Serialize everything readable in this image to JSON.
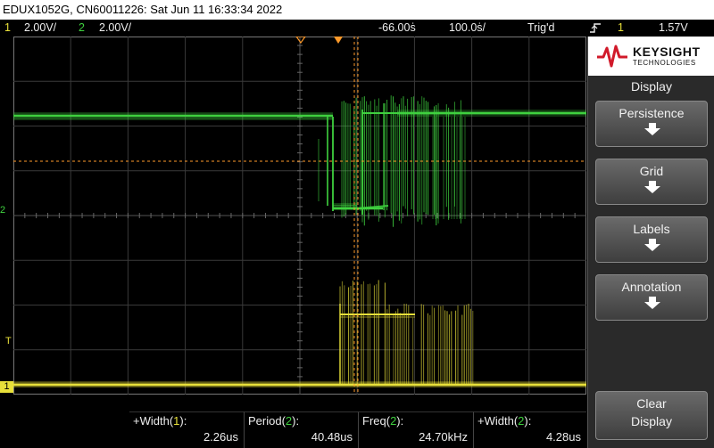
{
  "title": "EDUX1052G, CN60011226: Sat Jun 11 16:33:34 2022",
  "status": {
    "ch1_num": "1",
    "ch1_scale": "2.00V/",
    "ch2_num": "2",
    "ch2_scale": "2.00V/",
    "time_delay": "-66.00ṡ",
    "time_scale": "100.0ṡ/",
    "trigger_state": "Trig'd",
    "trigger_icon": "rising-edge-icon",
    "trigger_source": "1",
    "trigger_level": "1.57V"
  },
  "colors": {
    "ch1": "#e8e03a",
    "ch2": "#3fd13f",
    "marker": "#ff9a2a"
  },
  "markers": {
    "ch1": "1",
    "ch2": "2",
    "trigger_level": "T"
  },
  "brand": {
    "name": "KEYSIGHT",
    "sub": "TECHNOLOGIES"
  },
  "menu": {
    "title": "Display",
    "softkeys": [
      {
        "label": "Persistence"
      },
      {
        "label": "Grid"
      },
      {
        "label": "Labels"
      },
      {
        "label": "Annotation"
      }
    ],
    "clear_line1": "Clear",
    "clear_line2": "Display"
  },
  "measurements": [
    {
      "prefix": "+Width(",
      "ch": "1",
      "suffix": "):",
      "value": "2.26us"
    },
    {
      "prefix": "Period(",
      "ch": "2",
      "suffix": "):",
      "value": "40.48us"
    },
    {
      "prefix": "Freq(",
      "ch": "2",
      "suffix": "):",
      "value": "24.70kHz"
    },
    {
      "prefix": "+Width(",
      "ch": "2",
      "suffix": "):",
      "value": "4.28us"
    }
  ]
}
